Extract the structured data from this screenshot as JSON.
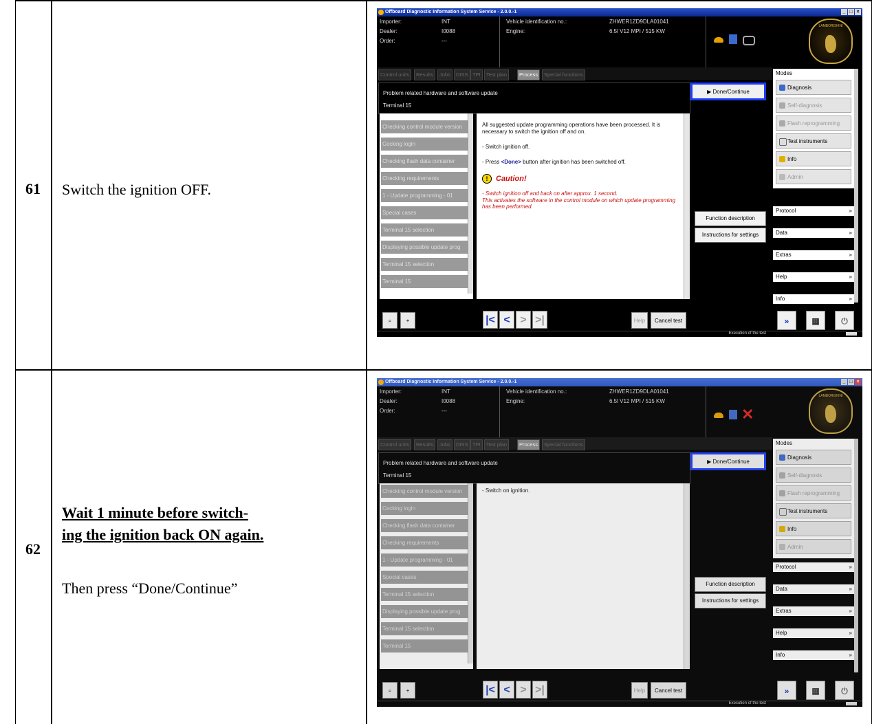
{
  "rows": [
    {
      "step": "61",
      "instructions": [
        "Switch the ignition OFF."
      ],
      "screen": {
        "window_title": "Offboard Diagnostic Information System Service - 2.0.0.-1",
        "header": {
          "importer_label": "Importer:",
          "importer_value": "INT",
          "dealer_label": "Dealer:",
          "dealer_value": "I0088",
          "order_label": "Order:",
          "order_value": "---",
          "vin_label": "Vehicle identification no.:",
          "vin_value": "ZHWER1ZD9DLA01041",
          "engine_label": "Engine:",
          "engine_value": "6.5l V12 MPI / 515 KW"
        },
        "logo_text": "LAMBORGHINI",
        "tabs": [
          "Control units",
          "Results",
          "Jobs",
          "DISS",
          "TPI",
          "Test plan",
          "Process",
          "Special functions"
        ],
        "active_tab": "Process",
        "panel_title": "Problem related hardware and software update",
        "panel_subtitle": "Terminal 15",
        "done_button": "▶  Done/Continue",
        "steps": [
          "Checking control module version",
          "Cecking login",
          "Checking flash data container",
          "Checking requirements",
          "1 - Update programming - 01",
          "Special cases",
          "Terminal 15 selection",
          "Displaying possible update prog",
          "Terminal 15 selection",
          "Terminal 15"
        ],
        "content": {
          "para1": "All suggested update programming operations have been processed. It is necessary to switch the ignition off and on.",
          "line2": "- Switch ignition off.",
          "line3_pre": "- Press ",
          "line3_btn": "<Done>",
          "line3_post": " button after ignition has been switched off.",
          "caution_title": "Caution!",
          "caution_text": "- Switch ignition off and back on after approx. 1 second.\nThis activates the software in the control module on which update programming has been performed."
        },
        "func_desc": "Function description",
        "instr_settings": "Instructions for settings",
        "modes_label": "Modes",
        "modes": [
          "Diagnosis",
          "Self-diagnosis",
          "Flash reprogramming",
          "Test instruments",
          "Info",
          "Admin"
        ],
        "side_sections": [
          "Protocol",
          "Data",
          "Extras",
          "Help",
          "Info"
        ],
        "help_btn": "Help",
        "cancel_btn": "Cancel test",
        "status_text": "Execution of the test"
      }
    },
    {
      "step": "62",
      "instructions": [
        "Wait 1 minute before switch-",
        "ing the ignition back ON again.",
        "Then press “Done/Continue”"
      ],
      "screen": {
        "window_title": "Offboard Diagnostic Information System Service - 2.0.0.-1",
        "header": {
          "importer_label": "Importer:",
          "importer_value": "INT",
          "dealer_label": "Dealer:",
          "dealer_value": "I0088",
          "order_label": "Order:",
          "order_value": "---",
          "vin_label": "Vehicle identification no.:",
          "vin_value": "ZHWER1ZD9DLA01041",
          "engine_label": "Engine:",
          "engine_value": "6.5l V12 MPI / 515 KW"
        },
        "logo_text": "LAMBORGHINI",
        "tabs": [
          "Control units",
          "Results",
          "Jobs",
          "DISS",
          "TPI",
          "Test plan",
          "Process",
          "Special functions"
        ],
        "active_tab": "Process",
        "panel_title": "Problem related hardware and software update",
        "panel_subtitle": "Terminal 15",
        "done_button": "▶  Done/Continue",
        "steps": [
          "Checking control module version",
          "Cecking login",
          "Checking flash data container",
          "Checking requirements",
          "1 - Update programming - 01",
          "Special cases",
          "Terminal 15 selection",
          "Displaying possible update prog",
          "Terminal 15 selection",
          "Terminal 15"
        ],
        "content": {
          "para1": "- Switch on ignition."
        },
        "func_desc": "Function description",
        "instr_settings": "Instructions for settings",
        "modes_label": "Modes",
        "modes": [
          "Diagnosis",
          "Self-diagnosis",
          "Flash reprogramming",
          "Test instruments",
          "Info",
          "Admin"
        ],
        "side_sections": [
          "Protocol",
          "Data",
          "Extras",
          "Help",
          "Info"
        ],
        "help_btn": "Help",
        "cancel_btn": "Cancel test",
        "status_text": "Execution of the test"
      }
    }
  ],
  "colors": {
    "highlight": "#1a3cff",
    "caution": "#cc1111",
    "nav_arrow": "#1a3cc0"
  }
}
